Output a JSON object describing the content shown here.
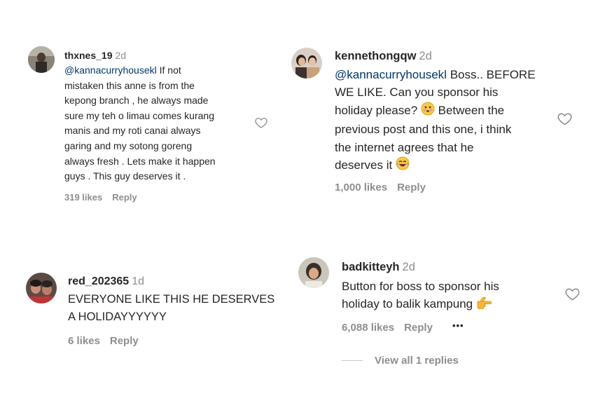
{
  "comments": [
    {
      "username": "thxnes_19",
      "time": "2d",
      "mention": "@kannacurryhousekl",
      "lines": [
        "If not",
        "mistaken this anne is from the",
        "kepong branch , he always made",
        "sure my teh o limau comes kurang",
        "manis and my roti canai always",
        "garing and my sotong goreng",
        "always fresh . Lets make it happen",
        "guys . This guy deserves it ."
      ],
      "likes": "319 likes",
      "reply": "Reply"
    },
    {
      "username": "kennethongqw",
      "time": "2d",
      "mention": "@kannacurryhousekl",
      "lines": [
        "Boss.. BEFORE",
        "WE LIKE. Can you sponsor his",
        "holiday please?",
        "Between the",
        "previous post and this one, i think",
        "the internet agrees that he",
        "deserves it"
      ],
      "likes": "1,000 likes",
      "reply": "Reply"
    },
    {
      "username": "red_202365",
      "time": "1d",
      "lines": [
        "EVERYONE LIKE THIS HE DESERVES",
        "A HOLIDAYYYYYY"
      ],
      "likes": "6 likes",
      "reply": "Reply"
    },
    {
      "username": "badkitteyh",
      "time": "2d",
      "lines": [
        "Button for boss to sponsor his",
        "holiday to balik kampung"
      ],
      "likes": "6,088 likes",
      "reply": "Reply",
      "more": "•••",
      "view_replies": "View all 1 replies"
    }
  ],
  "icons": {
    "heart": "heart-outline-icon",
    "more": "more-options-icon"
  },
  "colors": {
    "mention": "#00376b",
    "secondary": "#8e8e8e",
    "primary": "#262626"
  }
}
